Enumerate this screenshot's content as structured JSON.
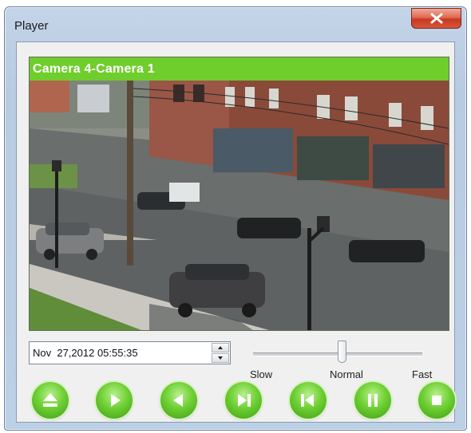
{
  "window": {
    "title": "Player"
  },
  "video": {
    "camera_label": "Camera 4-Camera 1",
    "header_color": "#6fcd2c"
  },
  "playback": {
    "datetime": "Nov  27,2012 05:55:35",
    "speed_labels": {
      "slow": "Slow",
      "normal": "Normal",
      "fast": "Fast"
    },
    "speed_position": 0.5
  },
  "controls": {
    "buttons": [
      "eject-icon",
      "play-icon",
      "reverse-play-icon",
      "step-forward-icon",
      "step-backward-icon",
      "pause-icon",
      "stop-icon"
    ],
    "button_color": "#6fd034"
  }
}
